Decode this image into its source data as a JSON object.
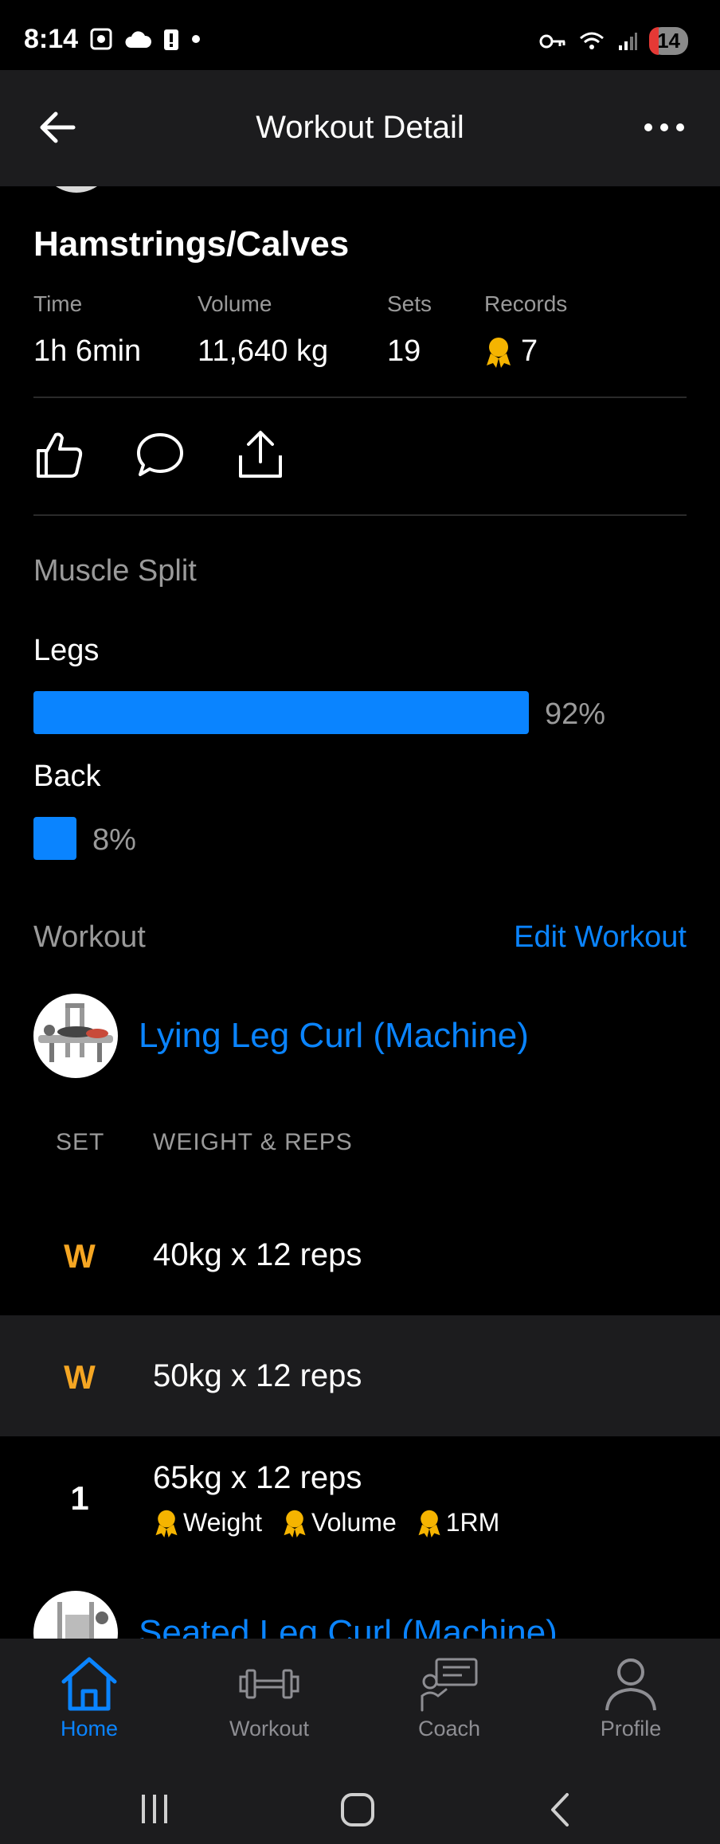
{
  "status_bar": {
    "time": "8:14",
    "battery": "14"
  },
  "header": {
    "title": "Workout Detail",
    "back_icon": "arrow-left-icon",
    "more_icon": "more-horizontal-icon"
  },
  "workout": {
    "title": "Hamstrings/Calves",
    "stats": [
      {
        "label": "Time",
        "value": "1h 6min"
      },
      {
        "label": "Volume",
        "value": "11,640 kg"
      },
      {
        "label": "Sets",
        "value": "19"
      },
      {
        "label": "Records",
        "value": "7"
      }
    ]
  },
  "actions": {
    "like_icon": "thumbs-up-icon",
    "comment_icon": "comment-icon",
    "share_icon": "share-icon"
  },
  "muscle_split": {
    "heading": "Muscle Split",
    "items": [
      {
        "name": "Legs",
        "percent_label": "92%",
        "percent": 92
      },
      {
        "name": "Back",
        "percent_label": "8%",
        "percent": 8
      }
    ]
  },
  "workout_section": {
    "heading": "Workout",
    "edit_label": "Edit Workout"
  },
  "exercises": [
    {
      "name": "Lying Leg Curl (Machine)",
      "set_header": "SET",
      "weight_header": "WEIGHT & REPS",
      "sets": [
        {
          "set": "W",
          "text": "40kg x 12 reps"
        },
        {
          "set": "W",
          "text": "50kg x 12 reps"
        },
        {
          "set": "1",
          "text": "65kg x 12 reps",
          "records": [
            "Weight",
            "Volume",
            "1RM"
          ]
        }
      ]
    },
    {
      "name": "Seated Leg Curl (Machine)"
    }
  ],
  "bottom_nav": [
    {
      "label": "Home",
      "icon": "home-icon",
      "active": true
    },
    {
      "label": "Workout",
      "icon": "dumbbell-icon",
      "active": false
    },
    {
      "label": "Coach",
      "icon": "coach-icon",
      "active": false
    },
    {
      "label": "Profile",
      "icon": "profile-icon",
      "active": false
    }
  ],
  "colors": {
    "accent": "#0a84ff",
    "warmup": "#f5a623",
    "medal": "#f5b400"
  }
}
